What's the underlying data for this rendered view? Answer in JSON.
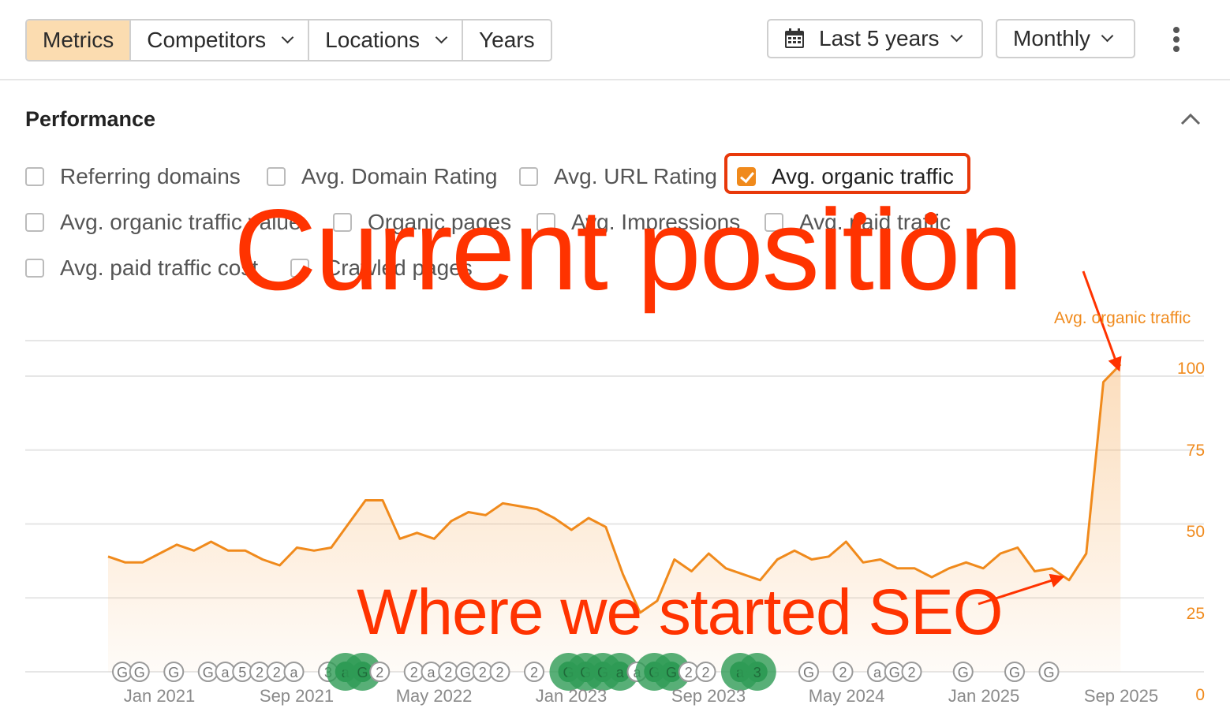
{
  "toolbar": {
    "tabs": [
      {
        "label": "Metrics",
        "active": true
      },
      {
        "label": "Competitors",
        "dropdown": true
      },
      {
        "label": "Locations",
        "dropdown": true
      },
      {
        "label": "Years",
        "dropdown": false
      }
    ],
    "date_range": "Last 5 years",
    "interval": "Monthly",
    "date_icon": "calendar-icon",
    "more_icon": "kebab-menu-icon"
  },
  "section": {
    "title": "Performance",
    "collapse_icon": "chevron-up-icon"
  },
  "metrics": {
    "referring_domains": {
      "label": "Referring domains",
      "checked": false
    },
    "avg_domain_rating": {
      "label": "Avg. Domain Rating",
      "checked": false
    },
    "avg_url_rating": {
      "label": "Avg. URL Rating",
      "checked": false
    },
    "avg_organic_traffic": {
      "label": "Avg. organic traffic",
      "checked": true
    },
    "avg_organic_traffic_value": {
      "label": "Avg. organic traffic value",
      "checked": false
    },
    "organic_pages": {
      "label": "Organic pages",
      "checked": false
    },
    "avg_impressions": {
      "label": "Avg. Impressions",
      "checked": false
    },
    "avg_paid_traffic": {
      "label": "Avg. paid traffic",
      "checked": false
    },
    "avg_paid_traffic_cost": {
      "label": "Avg. paid traffic cost",
      "checked": false
    },
    "crawled_pages": {
      "label": "Crawled pages",
      "checked": false
    }
  },
  "annotations": {
    "current_position": "Current position",
    "started_seo": "Where we started SEO",
    "color": "#ff3300"
  },
  "chart_data": {
    "type": "area",
    "series": [
      {
        "name": "Avg. organic traffic",
        "color": "#f08a1c",
        "values": [
          39,
          37,
          37,
          40,
          43,
          41,
          44,
          41,
          41,
          38,
          36,
          42,
          41,
          42,
          50,
          58,
          58,
          45,
          47,
          45,
          51,
          54,
          53,
          57,
          56,
          55,
          52,
          48,
          52,
          49,
          33,
          20,
          24,
          38,
          34,
          40,
          35,
          33,
          31,
          38,
          41,
          38,
          39,
          44,
          37,
          38,
          35,
          35,
          32,
          35,
          37,
          35,
          40,
          42,
          34,
          35,
          31,
          40,
          98,
          104
        ]
      }
    ],
    "x_start": "Jan 2021",
    "x_tick_labels": [
      "Jan 2021",
      "Sep 2021",
      "May 2022",
      "Jan 2023",
      "Sep 2023",
      "May 2024",
      "Jan 2025",
      "Sep 2025"
    ],
    "y_axis_label": "Avg. organic traffic",
    "y_ticks": [
      0,
      25,
      50,
      75,
      100
    ],
    "ylim": [
      0,
      100
    ],
    "grid": true,
    "y_axis_side": "right",
    "event_markers": [
      {
        "month": 0,
        "label": "G"
      },
      {
        "month": 1,
        "label": "G"
      },
      {
        "month": 3,
        "label": "G"
      },
      {
        "month": 5,
        "label": "G"
      },
      {
        "month": 6,
        "label": "a"
      },
      {
        "month": 7,
        "label": "5"
      },
      {
        "month": 8,
        "label": "2"
      },
      {
        "month": 9,
        "label": "2"
      },
      {
        "month": 10,
        "label": "a"
      },
      {
        "month": 12,
        "label": "3"
      },
      {
        "month": 13,
        "label": "a",
        "major": true
      },
      {
        "month": 14,
        "label": "G",
        "major": true
      },
      {
        "month": 15,
        "label": "2"
      },
      {
        "month": 17,
        "label": "2"
      },
      {
        "month": 18,
        "label": "a"
      },
      {
        "month": 19,
        "label": "2"
      },
      {
        "month": 20,
        "label": "G"
      },
      {
        "month": 21,
        "label": "2"
      },
      {
        "month": 22,
        "label": "2"
      },
      {
        "month": 24,
        "label": "2"
      },
      {
        "month": 26,
        "label": "G",
        "major": true
      },
      {
        "month": 27,
        "label": "G",
        "major": true
      },
      {
        "month": 28,
        "label": "G",
        "major": true
      },
      {
        "month": 29,
        "label": "a",
        "major": true
      },
      {
        "month": 30,
        "label": "a"
      },
      {
        "month": 31,
        "label": "G",
        "major": true
      },
      {
        "month": 32,
        "label": "G",
        "major": true
      },
      {
        "month": 33,
        "label": "2"
      },
      {
        "month": 34,
        "label": "2"
      },
      {
        "month": 36,
        "label": "a",
        "major": true
      },
      {
        "month": 37,
        "label": "3",
        "major": true
      },
      {
        "month": 40,
        "label": "G"
      },
      {
        "month": 42,
        "label": "2"
      },
      {
        "month": 44,
        "label": "a"
      },
      {
        "month": 45,
        "label": "G"
      },
      {
        "month": 46,
        "label": "2"
      },
      {
        "month": 49,
        "label": "G"
      },
      {
        "month": 52,
        "label": "G"
      },
      {
        "month": 54,
        "label": "G"
      }
    ]
  }
}
